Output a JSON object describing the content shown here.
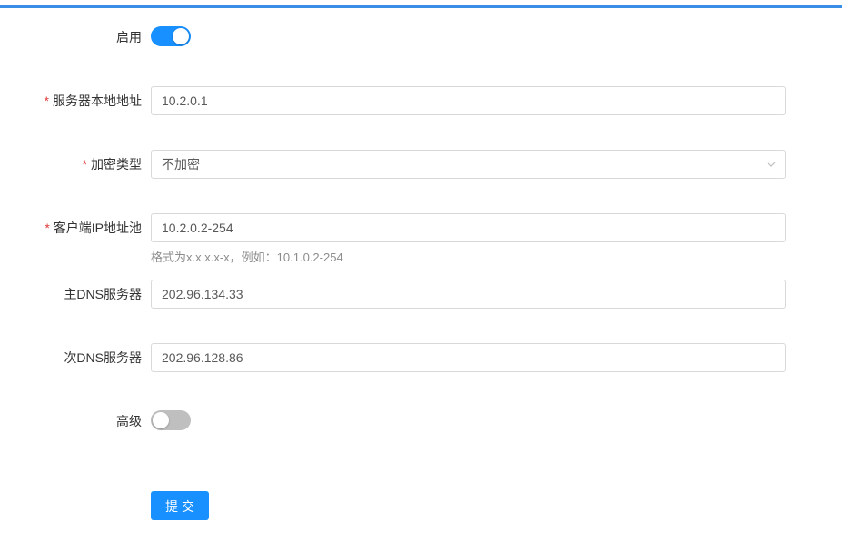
{
  "form": {
    "enable": {
      "label": "启用",
      "state": "on"
    },
    "server_local_address": {
      "label": "服务器本地地址",
      "required": true,
      "value": "10.2.0.1"
    },
    "encryption_type": {
      "label": "加密类型",
      "required": true,
      "value": "不加密",
      "icon": "chevron-down-icon"
    },
    "client_ip_pool": {
      "label": "客户端IP地址池",
      "required": true,
      "value": "10.2.0.2-254",
      "hint": "格式为x.x.x.x-x，例如：10.1.0.2-254"
    },
    "primary_dns": {
      "label": "主DNS服务器",
      "value": "202.96.134.33"
    },
    "secondary_dns": {
      "label": "次DNS服务器",
      "value": "202.96.128.86"
    },
    "advanced": {
      "label": "高级",
      "state": "off"
    },
    "submit_label": "提交"
  },
  "colors": {
    "accent": "#1890ff",
    "required": "#e03b3b",
    "switch_off": "#bfbfbf",
    "top_bar": "#3a8ee6"
  }
}
